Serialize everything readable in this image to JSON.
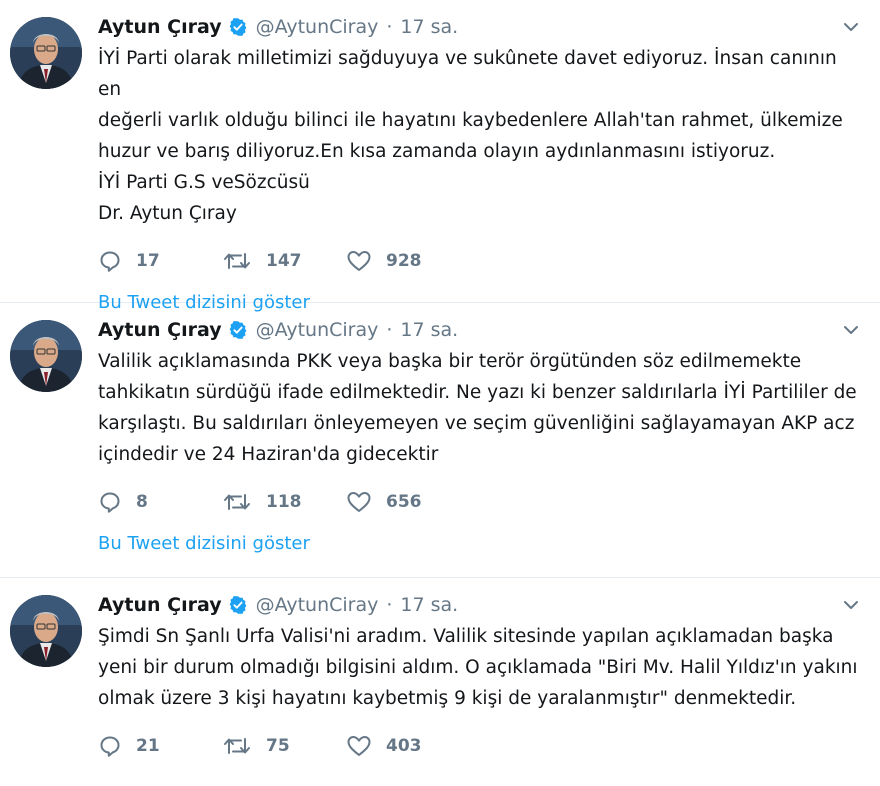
{
  "tweets": [
    {
      "name": "Aytun Çıray",
      "handle": "@AytunCiray",
      "separator": "·",
      "time": "17 sa.",
      "lines": [
        "İYİ Parti olarak milletimizi sağduyuya ve sukûnete davet ediyoruz. İnsan canının en",
        "değerli varlık olduğu bilinci ile hayatını kaybedenlere Allah'tan rahmet, ülkemize",
        "huzur ve barış diliyoruz.En kısa zamanda olayın aydınlanmasını istiyoruz.",
        "İYİ Parti G.S veSözcüsü",
        "Dr. Aytun Çıray"
      ],
      "replies": "17",
      "retweets": "147",
      "likes": "928",
      "thread_link": "Bu Tweet dizisini göster"
    },
    {
      "name": "Aytun Çıray",
      "handle": "@AytunCiray",
      "separator": "·",
      "time": "17 sa.",
      "lines": [
        "Valilik açıklamasında PKK veya başka bir terör örgütünden söz edilmemekte",
        "tahkikatın sürdüğü ifade edilmektedir. Ne yazı ki benzer saldırılarla İYİ Partililer de",
        "karşılaştı. Bu saldırıları önleyemeyen ve seçim güvenliğini sağlayamayan AKP acz",
        "içindedir ve 24 Haziran'da gidecektir"
      ],
      "replies": "8",
      "retweets": "118",
      "likes": "656",
      "thread_link": "Bu Tweet dizisini göster"
    },
    {
      "name": "Aytun Çıray",
      "handle": "@AytunCiray",
      "separator": "·",
      "time": "17 sa.",
      "lines": [
        "Şimdi Sn Şanlı Urfa Valisi'ni aradım. Valilik sitesinde yapılan açıklamadan başka",
        "yeni bir durum olmadığı bilgisini aldım. O açıklamada \"Biri Mv. Halil Yıldız'ın yakını",
        "olmak üzere 3 kişi hayatını kaybetmiş 9 kişi de yaralanmıştır\" denmektedir."
      ],
      "replies": "21",
      "retweets": "75",
      "likes": "403"
    }
  ],
  "colors": {
    "link": "#1da1f2",
    "verified": "#1da1f2",
    "muted": "#657786",
    "text": "#14171a",
    "divider": "#e6ecf0"
  },
  "icons": [
    "verified-badge-icon",
    "chevron-down-icon",
    "reply-icon",
    "retweet-icon",
    "like-icon",
    "avatar"
  ]
}
